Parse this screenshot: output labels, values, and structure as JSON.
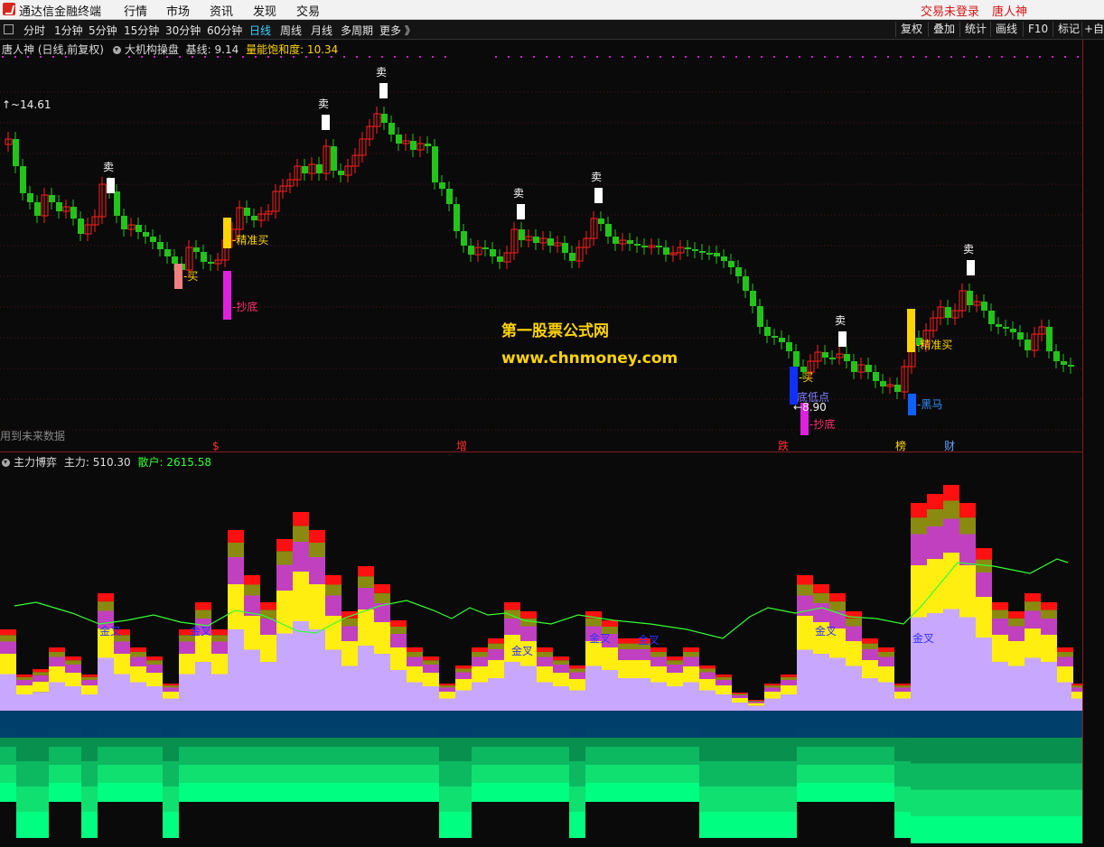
{
  "menu": {
    "app_title": "通达信金融终端",
    "items": [
      "行情",
      "市场",
      "资讯",
      "发现",
      "交易"
    ],
    "login_status": "交易未登录",
    "user": "唐人神"
  },
  "periods": {
    "items": [
      "分时",
      "1分钟",
      "5分钟",
      "15分钟",
      "30分钟",
      "60分钟",
      "日线",
      "周线",
      "月线",
      "多周期",
      "更多 》"
    ],
    "active": "日线"
  },
  "toolbar_right": [
    "复权",
    "叠加",
    "统计",
    "画线",
    "F10",
    "标记",
    "+自"
  ],
  "main": {
    "stock_label": "唐人神 (日线,前复权)",
    "indicator_name": "大机构操盘",
    "baseline_label": "基线: 9.14",
    "energy_label": "量能饱和度: 10.34",
    "high_price": "14.61",
    "low_price": "8.90",
    "future_data_note": "用到未来数据",
    "watermark_cn": "第一股票公式网",
    "watermark_url": "www.chnmoney.com",
    "signals": {
      "sell": "卖",
      "buy": "买",
      "precise_buy": "精准买",
      "bottom_fish": "抄底",
      "black_horse": "黑马",
      "low_point": "底低点"
    },
    "event_markers": [
      "$",
      "增",
      "跌",
      "榜",
      "财"
    ]
  },
  "sub": {
    "indicator_name": "主力博弈",
    "main_force_label": "主力: 510.30",
    "retail_label": "散户: 2615.58",
    "golden_cross": "金叉"
  },
  "colors": {
    "up": "#ff2020",
    "down": "#22c41a",
    "grid": "#5a1010",
    "yellow_label": "#ffd400",
    "retail": "#33ff33",
    "bg": "#0a0a0a"
  },
  "icons": [
    "logo-icon",
    "window-icon",
    "dropdown-circle-icon"
  ]
}
